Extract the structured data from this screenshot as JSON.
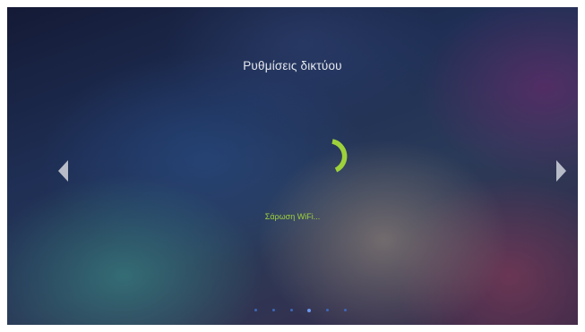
{
  "screen": {
    "title": "Ρυθμίσεις δικτύου",
    "status_text": "Σάρωση WiFi...",
    "nav": {
      "prev_icon": "chevron-left-icon",
      "next_icon": "chevron-right-icon"
    },
    "spinner_icon": "loading-spinner-icon",
    "pager": {
      "page_count": 6,
      "current_page": 4
    }
  },
  "colors": {
    "title": "#e6e8ee",
    "accent_green": "#9ed23b",
    "arrow": "#b8bcc9",
    "dot": "#3f67b8",
    "dot_active": "#6a97f0"
  }
}
